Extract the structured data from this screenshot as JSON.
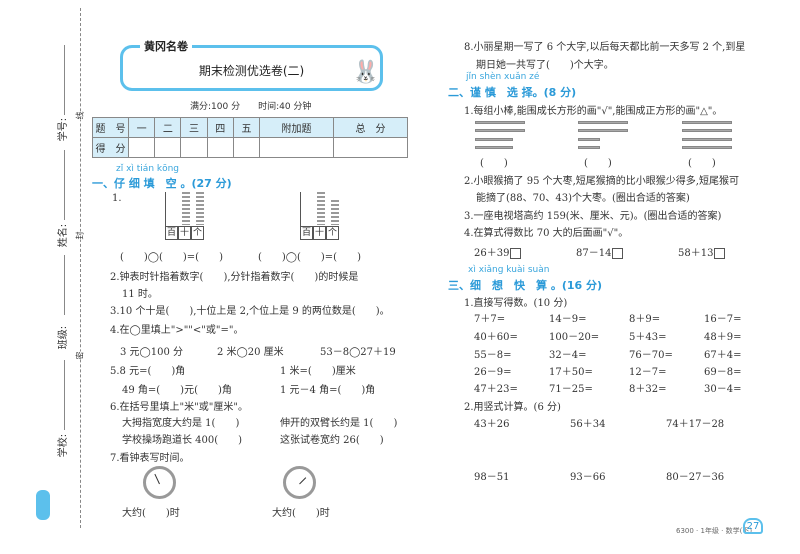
{
  "margin": {
    "labels": [
      "学号:",
      "姓名:",
      "班级:",
      "学校:"
    ],
    "cut_marks": [
      "线",
      "封",
      "密"
    ]
  },
  "header": {
    "logo": "黄冈名卷",
    "title": "期末检测优选卷(二)",
    "meta": "满分:100 分　　时间:40 分钟"
  },
  "score_table": {
    "headers": [
      "题　号",
      "一",
      "二",
      "三",
      "四",
      "五",
      "附加题",
      "总　分"
    ],
    "row_label": "得　分"
  },
  "section1": {
    "pinyin": "zǐ xì tián kōng",
    "title": "一、仔 细 填　空 。(27 分)",
    "q1": {
      "num": "1.",
      "place_labels": [
        "百",
        "十",
        "个"
      ],
      "answer_line": "(　　)◯(　　)=(　　)"
    },
    "q2a": "2.钟表时针指着数字(　　),分针指着数字(　　)的时候是",
    "q2b": "11 时。",
    "q3": "3.10 个十是(　　),十位上是 2,个位上是 9 的两位数是(　　)。",
    "q4": "4.在◯里填上\">\"\"<\"或\"=\"。",
    "q4_items": [
      "3 元◯100 分",
      "2 米◯20 厘米",
      "53－8◯27＋19"
    ],
    "q5": [
      "5.8 元=(　　)角",
      "1 米=(　　)厘米",
      "49 角=(　　)元(　　)角",
      "1 元－4 角=(　　)角"
    ],
    "q6": "6.在括号里填上\"米\"或\"厘米\"。",
    "q6_items": [
      "大拇指宽度大约是 1(　　)",
      "伸开的双臂长约是 1(　　)",
      "学校操场跑道长 400(　　)",
      "这张试卷宽约 26(　　)"
    ],
    "q7": "7.看钟表写时间。",
    "q7_answers": [
      "大约(　　)时",
      "大约(　　)时"
    ]
  },
  "q8": [
    "8.小丽星期一写了 6 个大字,以后每天都比前一天多写 2 个,到星",
    "期日她一共写了(　　)个大字。"
  ],
  "section2": {
    "pinyin": "jǐn shèn xuǎn zé",
    "title": "二、谨 慎　选 择。(8 分)",
    "q1": "1.每组小棒,能围成长方形的画\"√\",能围成正方形的画\"△\"。",
    "q1_answer": "(　　)",
    "q2": [
      "2.小眼猴摘了 95 个大枣,短尾猴摘的比小眼猴少得多,短尾猴可",
      "能摘了(88、70、43)个大枣。(圈出合适的答案)"
    ],
    "q3": "3.一座电视塔高约 159(米、厘米、元)。(圈出合适的答案)",
    "q4": "4.在算式得数比 70 大的后面画\"√\"。",
    "q4_items": [
      "26＋39",
      "87－14",
      "58＋13"
    ]
  },
  "section3": {
    "pinyin": "xì xiǎng kuài suàn",
    "title": "三、细　想　快　算 。(16 分)",
    "q1": "1.直接写得数。(10 分)",
    "q1_items": [
      [
        "7＋7=",
        "14－9=",
        "8＋9=",
        "16－7="
      ],
      [
        "40＋60=",
        "100－20=",
        "5＋43=",
        "48＋9="
      ],
      [
        "55－8=",
        "32－4=",
        "76－70=",
        "67＋4="
      ],
      [
        "26－9=",
        "17＋50=",
        "12－7=",
        "69－8="
      ],
      [
        "47＋23=",
        "71－25=",
        "8＋32=",
        "30－4="
      ]
    ],
    "q2": "2.用竖式计算。(6 分)",
    "q2_items": [
      [
        "43＋26",
        "56＋34",
        "74＋17－28"
      ],
      [
        "98－51",
        "93－66",
        "80－27－36"
      ]
    ]
  },
  "footer": {
    "text": "6300 · 1年级 · 数学(下)",
    "page": "27"
  }
}
